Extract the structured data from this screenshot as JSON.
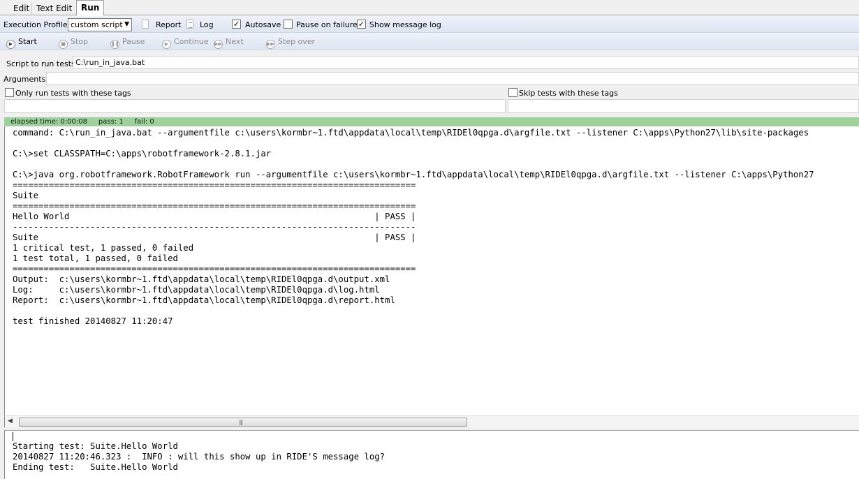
{
  "tabs": [
    {
      "label": "Edit"
    },
    {
      "label": "Text Edit"
    },
    {
      "label": "Run"
    }
  ],
  "toolbar": {
    "profile_label": "Execution Profile:",
    "profile_value": "custom script",
    "report_label": "Report",
    "log_label": "Log",
    "autosave_label": "Autosave",
    "autosave_checked": true,
    "pause_label": "Pause on failure",
    "pause_checked": false,
    "showlog_label": "Show message log",
    "showlog_checked": true
  },
  "run_buttons": {
    "start": "Start",
    "stop": "Stop",
    "pause": "Pause",
    "continue": "Continue",
    "next": "Next",
    "step_over": "Step over"
  },
  "script": {
    "label": "Script to run tests:",
    "value": "C:\\run_in_java.bat"
  },
  "arguments": {
    "label": "Arguments:",
    "value": ""
  },
  "tags": {
    "include_label": "Only run tests with these tags",
    "exclude_label": "Skip tests with these tags"
  },
  "status": {
    "text": "elapsed time: 0:00:08     pass: 1     fail: 0",
    "color": "#9ed19c"
  },
  "console_text": "command: C:\\run_in_java.bat --argumentfile c:\\users\\kormbr~1.ftd\\appdata\\local\\temp\\RIDEl0qpga.d\\argfile.txt --listener C:\\apps\\Python27\\lib\\site-packages\n\nC:\\>set CLASSPATH=C:\\apps\\robotframework-2.8.1.jar\n\nC:\\>java org.robotframework.RobotFramework run --argumentfile c:\\users\\kormbr~1.ftd\\appdata\\local\\temp\\RIDEl0qpga.d\\argfile.txt --listener C:\\apps\\Python27\n==============================================================================\nSuite\n==============================================================================\nHello World                                                           | PASS |\n------------------------------------------------------------------------------\nSuite                                                                 | PASS |\n1 critical test, 1 passed, 0 failed\n1 test total, 1 passed, 0 failed\n==============================================================================\nOutput:  c:\\users\\kormbr~1.ftd\\appdata\\local\\temp\\RIDEl0qpga.d\\output.xml\nLog:     c:\\users\\kormbr~1.ftd\\appdata\\local\\temp\\RIDEl0qpga.d\\log.html\nReport:  c:\\users\\kormbr~1.ftd\\appdata\\local\\temp\\RIDEl0qpga.d\\report.html\n\ntest finished 20140827 11:20:47",
  "message_log_text": "Starting test: Suite.Hello World\n20140827 11:20:46.323 :  INFO : will this show up in RIDE'S message log?\nEnding test:   Suite.Hello World"
}
